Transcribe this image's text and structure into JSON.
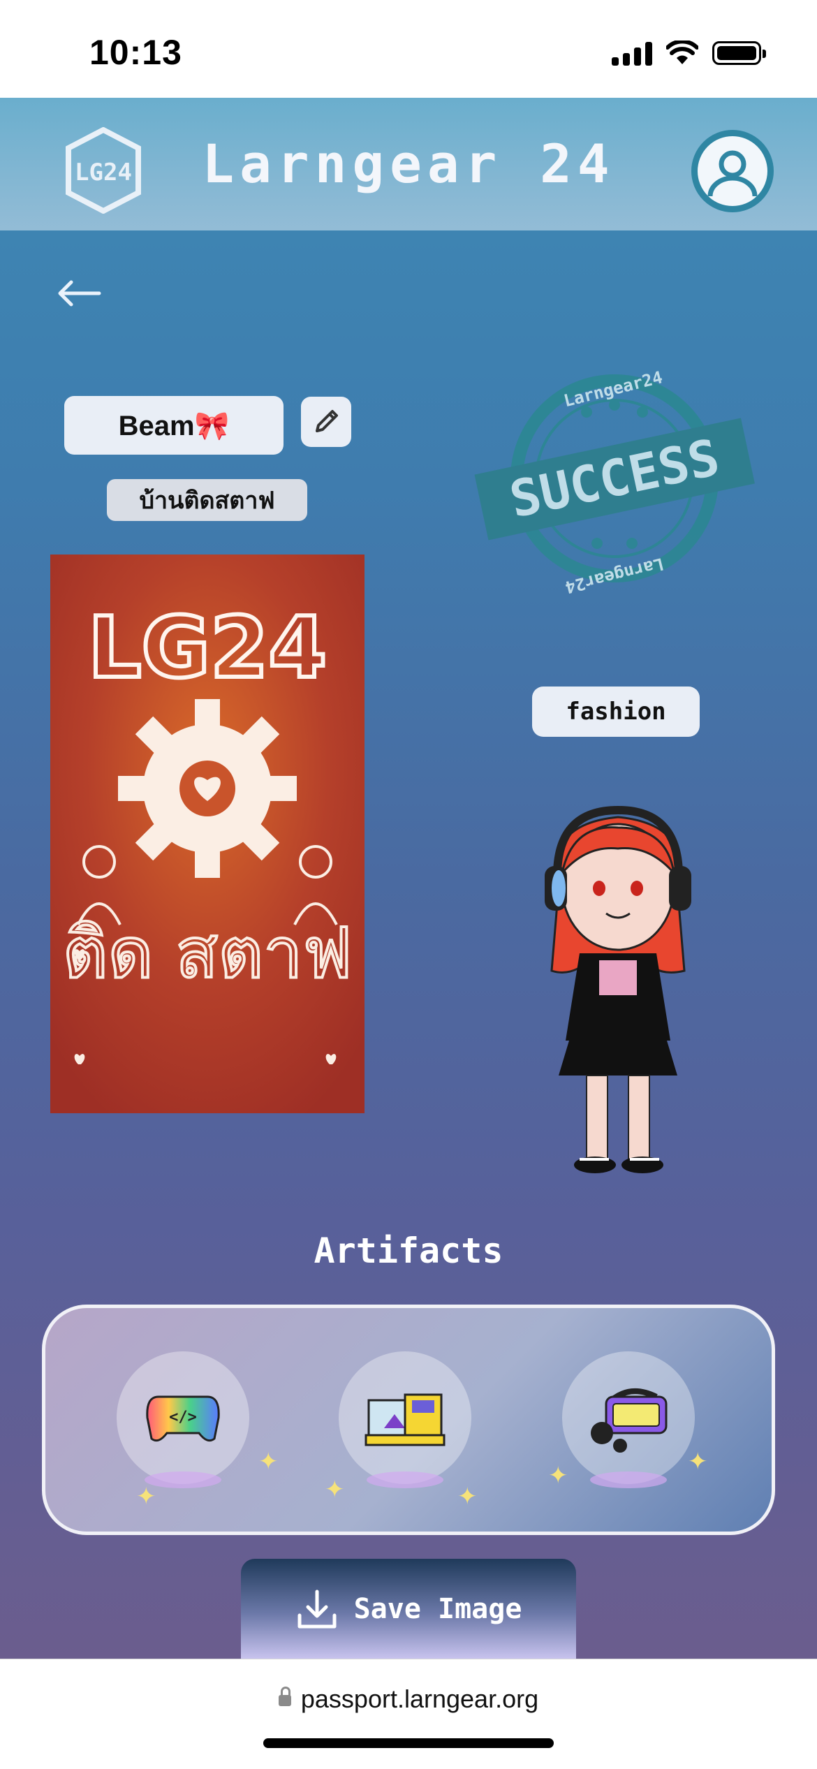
{
  "status_bar": {
    "time": "10:13"
  },
  "header": {
    "brand": "Larngear 24",
    "logo_text": "LG24"
  },
  "profile": {
    "name": "Beam🎀",
    "house": "บ้านติดสตาฟ",
    "tag": "fashion",
    "card_text_top": "LG24",
    "card_text_bottom": "ติด สตาฟ",
    "stamp_main": "SUCCESS",
    "stamp_ring": "Larngear24"
  },
  "artifacts": {
    "title": "Artifacts",
    "items": [
      {
        "icon": "rainbow-gamepad-icon"
      },
      {
        "icon": "yellow-3d-printer-icon"
      },
      {
        "icon": "keyboard-headset-icon"
      }
    ]
  },
  "actions": {
    "save_label": "Save Image"
  },
  "browser": {
    "url": "passport.larngear.org"
  },
  "colors": {
    "accent": "#2f86a3",
    "pill": "#e9eef6",
    "stamp": "#2f7f8f"
  }
}
